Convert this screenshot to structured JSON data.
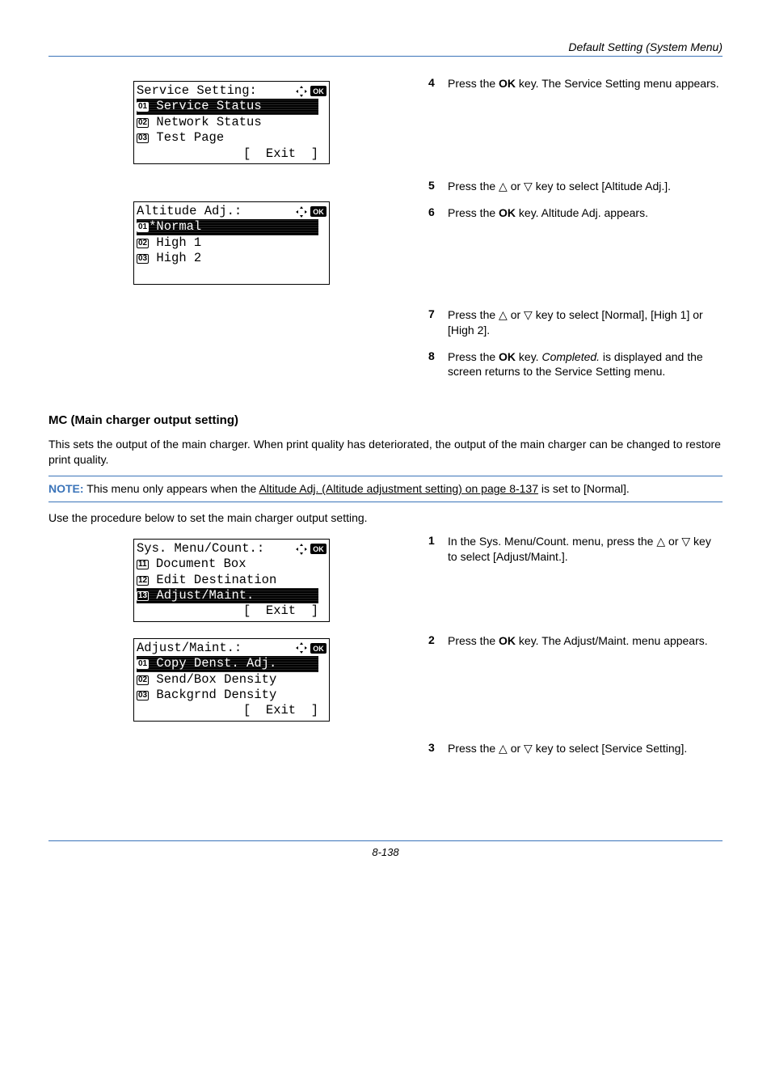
{
  "header": {
    "title": "Default Setting (System Menu)"
  },
  "lcd1": {
    "title": "Service Setting:",
    "row1": {
      "num": "01",
      "text": " Service Status"
    },
    "row2": {
      "num": "02",
      "text": " Network Status"
    },
    "row3": {
      "num": "03",
      "text": " Test Page"
    },
    "exit": "[  Exit  ]"
  },
  "lcd2": {
    "title": "Altitude Adj.:",
    "row1": {
      "num": "01",
      "text": "*Normal"
    },
    "row2": {
      "num": "02",
      "text": " High 1"
    },
    "row3": {
      "num": "03",
      "text": " High 2"
    }
  },
  "lcd3": {
    "title": "Sys. Menu/Count.:",
    "row1": {
      "num": "11",
      "text": " Document Box"
    },
    "row2": {
      "num": "12",
      "text": " Edit Destination"
    },
    "row3": {
      "num": "13",
      "text": " Adjust/Maint."
    },
    "exit": "[  Exit  ]"
  },
  "lcd4": {
    "title": "Adjust/Maint.:",
    "row1": {
      "num": "01",
      "text": " Copy Denst. Adj."
    },
    "row2": {
      "num": "02",
      "text": " Send/Box Density"
    },
    "row3": {
      "num": "03",
      "text": " Backgrnd Density"
    },
    "exit": "[  Exit  ]"
  },
  "steps_a": {
    "s4n": "4",
    "s4t_a": "Press the ",
    "s4t_b": "OK",
    "s4t_c": " key. The Service Setting menu appears.",
    "s5n": "5",
    "s5t_a": "Press the ",
    "s5t_b": " or ",
    "s5t_c": " key to select [Altitude Adj.].",
    "s6n": "6",
    "s6t_a": "Press the ",
    "s6t_b": "OK",
    "s6t_c": " key. Altitude Adj. appears.",
    "s7n": "7",
    "s7t_a": "Press the ",
    "s7t_b": " or ",
    "s7t_c": " key to select [Normal], [High 1] or [High 2].",
    "s8n": "8",
    "s8t_a": "Press the ",
    "s8t_b": "OK",
    "s8t_c": " key. ",
    "s8t_d": "Completed.",
    "s8t_e": " is displayed and the screen returns to the Service Setting menu."
  },
  "section": {
    "heading": "MC (Main charger output setting)",
    "p1": "This sets the output of the main charger. When print quality has deteriorated, the output of the main charger can be changed to restore print quality.",
    "note_label": "NOTE:",
    "note_a": " This menu only appears when the ",
    "note_link": "Altitude Adj. (Altitude adjustment setting) on page 8-137",
    "note_b": " is set to [Normal].",
    "p2": "Use the procedure below to set the main charger output setting."
  },
  "steps_b": {
    "s1n": "1",
    "s1t_a": "In the Sys. Menu/Count. menu, press the ",
    "s1t_b": " or ",
    "s1t_c": " key to select [Adjust/Maint.].",
    "s2n": "2",
    "s2t_a": "Press the ",
    "s2t_b": "OK",
    "s2t_c": " key. The Adjust/Maint. menu appears.",
    "s3n": "3",
    "s3t_a": "Press the ",
    "s3t_b": " or ",
    "s3t_c": " key to select [Service Setting]."
  },
  "footer": {
    "page": "8-138"
  },
  "glyphs": {
    "up": "△",
    "down": "▽"
  }
}
